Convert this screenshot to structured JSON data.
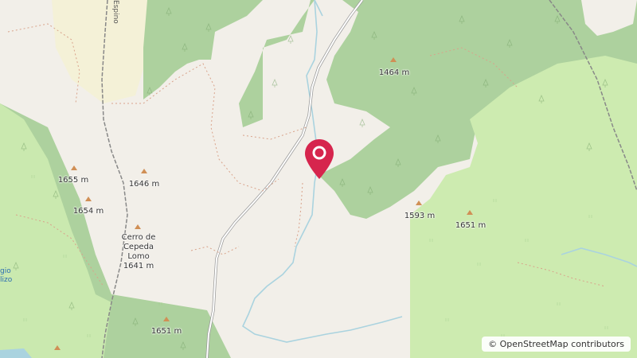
{
  "map": {
    "peaks": [
      {
        "id": "p1464",
        "name": "",
        "elevation": "1464 m"
      },
      {
        "id": "p1655",
        "name": "",
        "elevation": "1655 m"
      },
      {
        "id": "p1646",
        "name": "",
        "elevation": "1646 m"
      },
      {
        "id": "p1654",
        "name": "",
        "elevation": "1654 m"
      },
      {
        "id": "p1641",
        "name": "Cerro de Cepeda Lomo",
        "elevation": "1641 m"
      },
      {
        "id": "p1593",
        "name": "",
        "elevation": "1593 m"
      },
      {
        "id": "p1651a",
        "name": "",
        "elevation": "1651 m"
      },
      {
        "id": "p1651b",
        "name": "",
        "elevation": "1651 m"
      }
    ],
    "road_label": "Espino",
    "water_label_partial": "gio\nlizo",
    "attribution": "© OpenStreetMap contributors",
    "marker_color": "#d6254d",
    "colors": {
      "forest": "#add19e",
      "meadow": "#cdebb0",
      "background": "#f2efe9",
      "water": "#aad3df",
      "peak": "#d08f55"
    }
  }
}
